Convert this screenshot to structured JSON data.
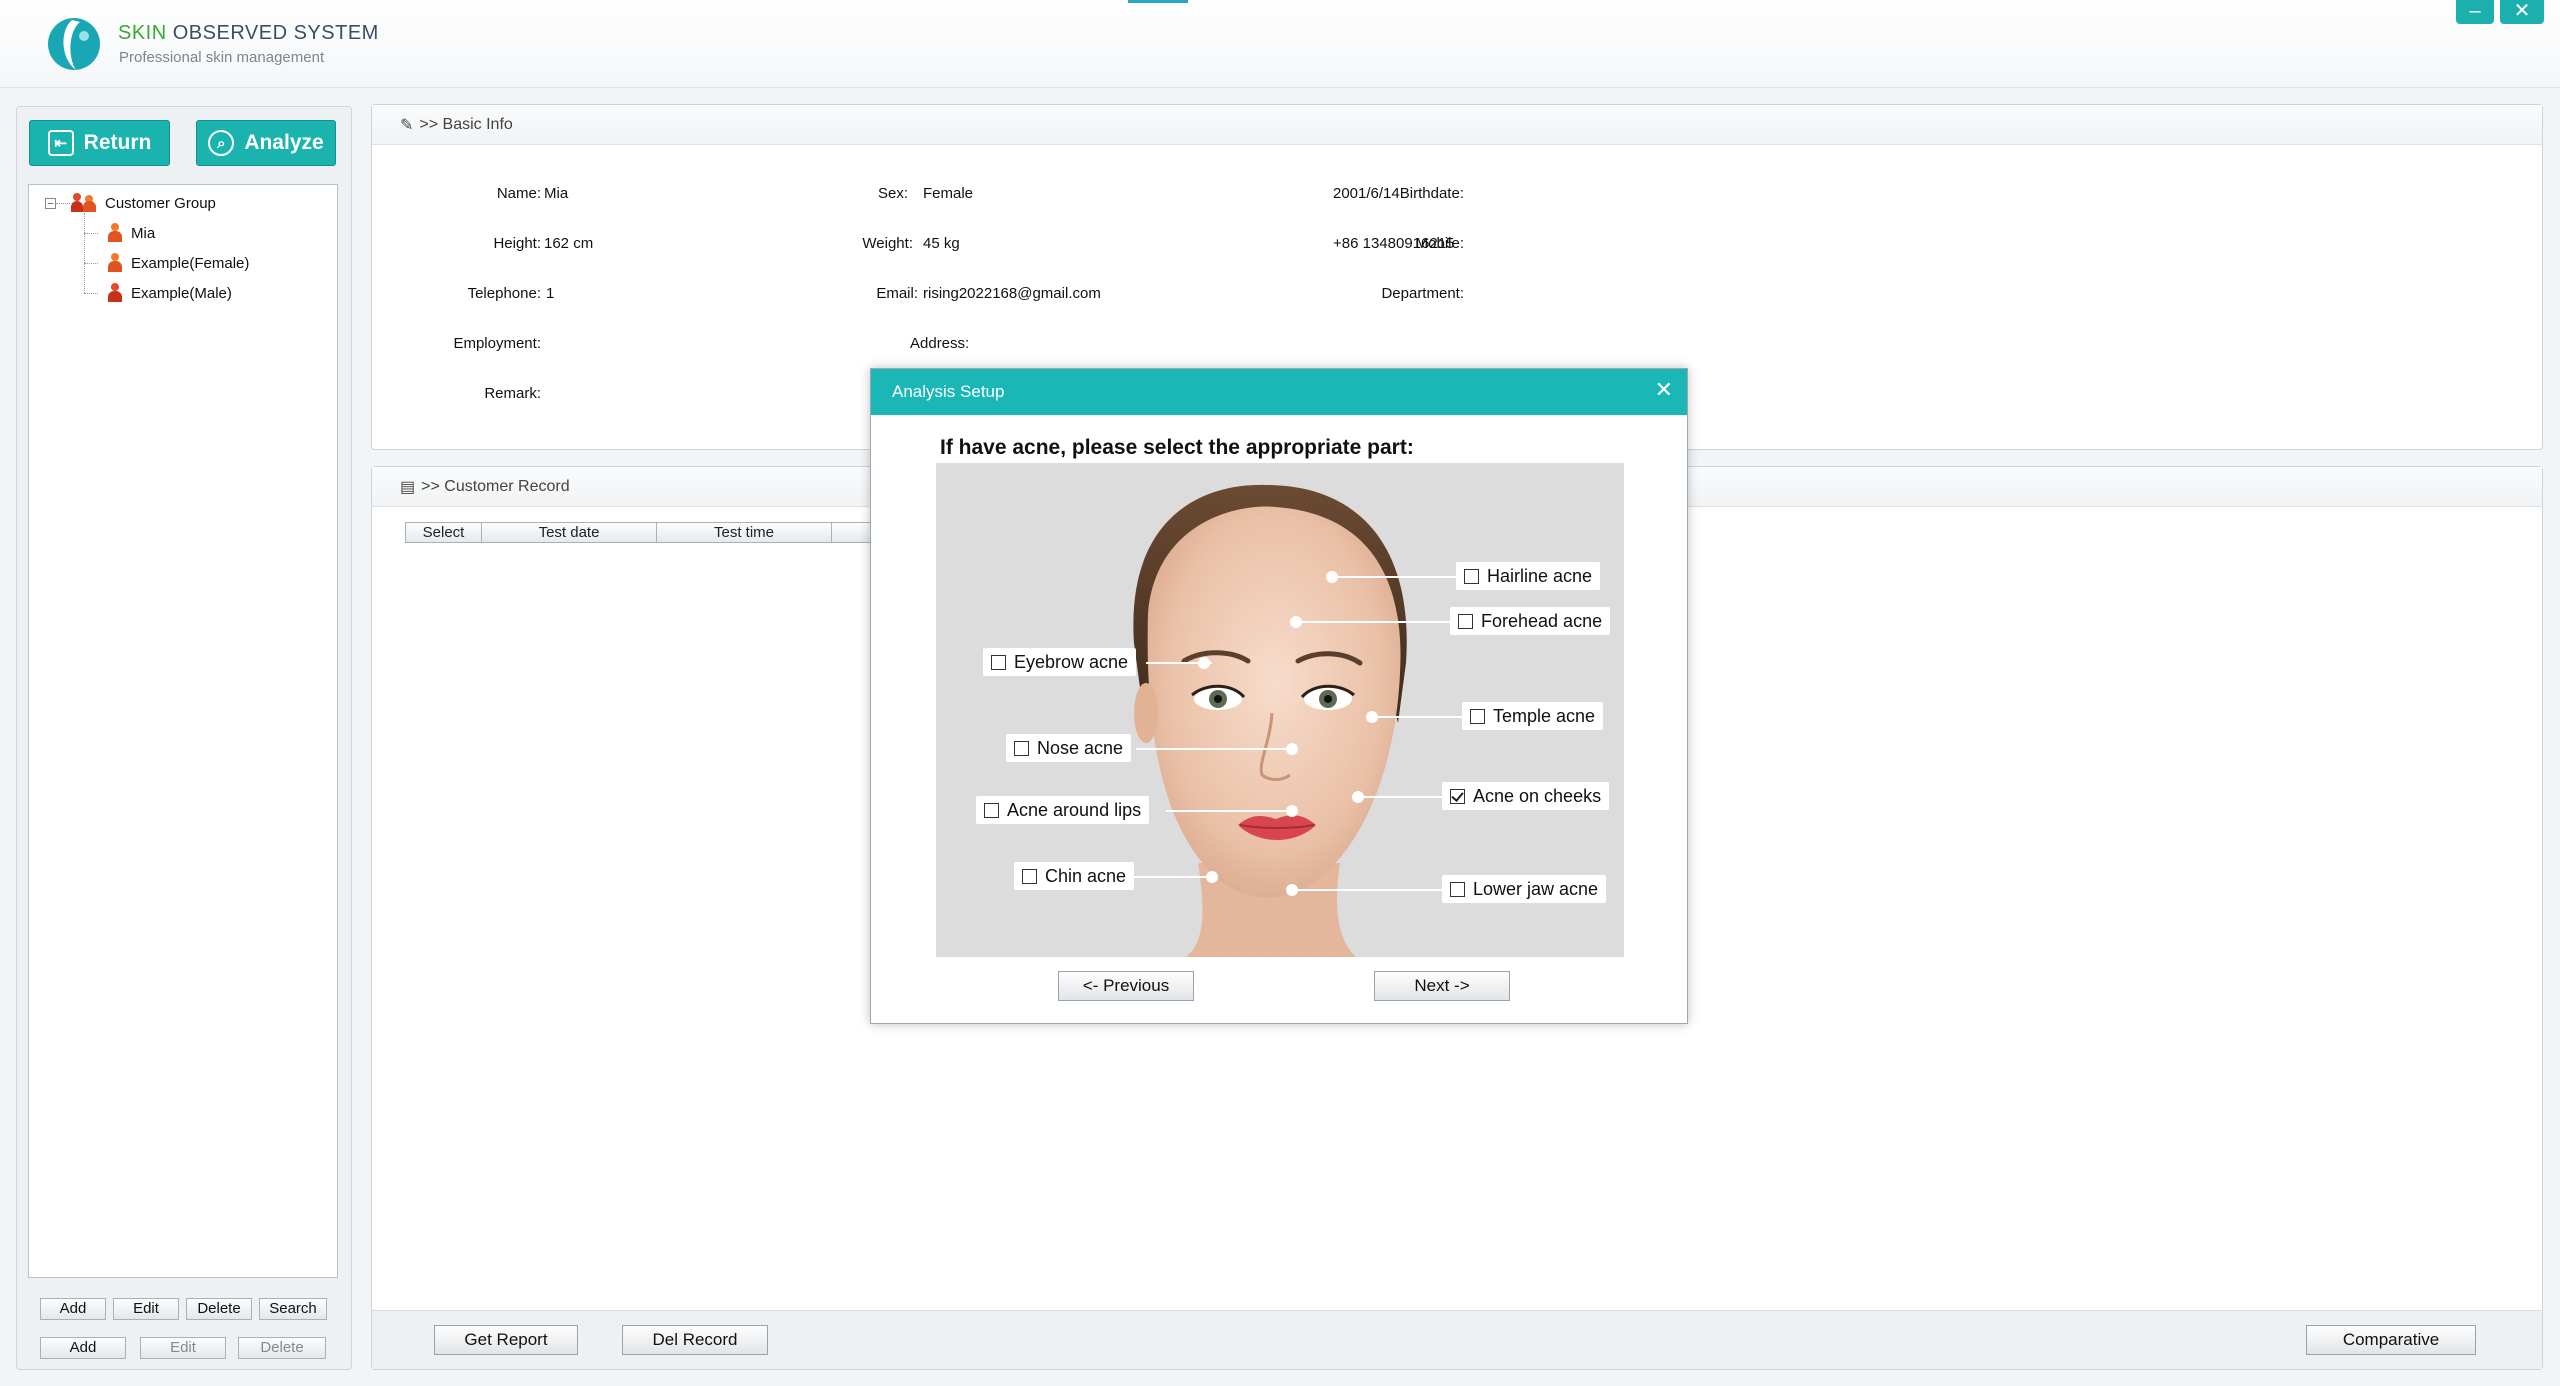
{
  "app": {
    "title_prefix": "SKIN",
    "title_rest": " OBSERVED SYSTEM",
    "subtitle": "Professional skin management",
    "minimize": "–",
    "close": "✕"
  },
  "left": {
    "return_label": "Return",
    "analyze_label": "Analyze",
    "tree": {
      "root": "Customer Group",
      "expander": "⊟",
      "children": [
        "Mia",
        "Example(Female)",
        "Example(Male)"
      ]
    },
    "row1": [
      "Add",
      "Edit",
      "Delete",
      "Search"
    ],
    "row2": [
      "Add",
      "Edit",
      "Delete"
    ]
  },
  "basic_info": {
    "header": ">> Basic Info",
    "fields": {
      "name_label": "Name:",
      "name": "Mia",
      "sex_label": "Sex:",
      "sex": "Female",
      "birthdate_label": "Birthdate:",
      "birthdate": "2001/6/14",
      "height_label": "Height:",
      "height": "162 cm",
      "weight_label": "Weight:",
      "weight": "45 kg",
      "mobile_label": "Mobile:",
      "mobile": "+86 13480916215",
      "telephone_label": "Telephone:",
      "telephone": "1",
      "email_label": "Email:",
      "email": "rising2022168@gmail.com",
      "department_label": "Department:",
      "employment_label": "Employment:",
      "address_label": "Address:",
      "remark_label": "Remark:"
    }
  },
  "customer_record": {
    "header": ">> Customer Record",
    "columns": [
      "Select",
      "Test date",
      "Test time",
      ""
    ],
    "buttons": {
      "get_report": "Get Report",
      "del_record": "Del Record",
      "comparative": "Comparative"
    }
  },
  "dialog": {
    "title": "Analysis Setup",
    "close": "✕",
    "prompt": "If have acne, please select the appropriate part:",
    "options": {
      "hairline": {
        "label": "Hairline acne",
        "checked": false
      },
      "forehead": {
        "label": "Forehead acne",
        "checked": false
      },
      "eyebrow": {
        "label": "Eyebrow acne",
        "checked": false
      },
      "temple": {
        "label": "Temple acne",
        "checked": false
      },
      "nose": {
        "label": "Nose acne",
        "checked": false
      },
      "cheeks": {
        "label": "Acne on cheeks",
        "checked": true
      },
      "lips": {
        "label": "Acne around lips",
        "checked": false
      },
      "chin": {
        "label": "Chin acne",
        "checked": false
      },
      "lower_jaw": {
        "label": "Lower jaw acne",
        "checked": false
      }
    },
    "prev_label": "<- Previous",
    "next_label": "Next ->"
  },
  "colors": {
    "accent": "#1bb3ae",
    "header_teal": "#1bb6b6",
    "logo_green": "#3aa832"
  }
}
